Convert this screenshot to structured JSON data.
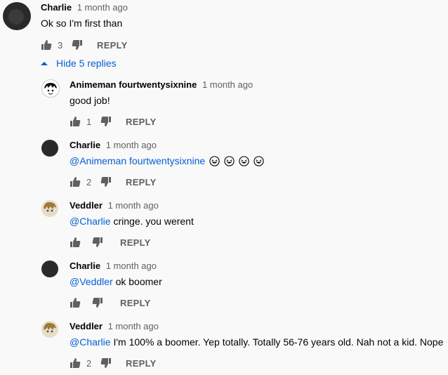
{
  "comments": [
    {
      "author": "Charlie",
      "time": "1 month ago",
      "text": "Ok so I'm first than",
      "likes": "3",
      "reply": "REPLY"
    },
    {
      "toggle": "Hide 5 replies"
    }
  ],
  "replies": [
    {
      "author": "Animeman fourtwentysixnine",
      "time": "1 month ago",
      "text": "good job!",
      "likes": "1",
      "reply": "REPLY"
    },
    {
      "author": "Charlie",
      "time": "1 month ago",
      "mention": "@Animeman fourtwentysixnine",
      "text": "",
      "likes": "2",
      "reply": "REPLY",
      "emoji_count": 4
    },
    {
      "author": "Veddler",
      "time": "1 month ago",
      "mention": "@Charlie",
      "text": " cringe. you werent",
      "likes": "",
      "reply": "REPLY"
    },
    {
      "author": "Charlie",
      "time": "1 month ago",
      "mention": "@Veddler",
      "text": " ok boomer",
      "likes": "",
      "reply": "REPLY"
    },
    {
      "author": "Veddler",
      "time": "1 month ago",
      "mention": "@Charlie",
      "text": " I'm 100% a boomer. Yep totally. Totally 56-76 years old. Nah not a kid. Nope",
      "likes": "2",
      "reply": "REPLY"
    }
  ],
  "colors": {
    "link": "#065fd4",
    "meta": "#606060",
    "text": "#030303",
    "bg": "#f9f9f9"
  },
  "icons": {
    "like": "thumbs-up-icon",
    "dislike": "thumbs-down-icon",
    "toggle": "caret-up-icon",
    "emoji": "laughing-emoji-icon"
  }
}
